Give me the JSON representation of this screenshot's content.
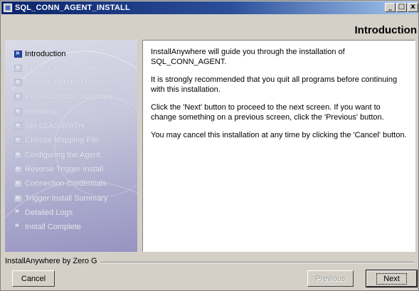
{
  "window": {
    "title": "SQL_CONN_AGENT_INSTALL",
    "controls": [
      "_",
      "□",
      "x"
    ]
  },
  "header": {
    "title": "Introduction"
  },
  "steps": [
    {
      "label": "Introduction",
      "state": "current"
    },
    {
      "label": "Choose Install Folder",
      "state": "pending"
    },
    {
      "label": "Choose Shortcut Folder",
      "state": "pending"
    },
    {
      "label": "Pre-Installation Summary",
      "state": "pending"
    },
    {
      "label": "Installing...",
      "state": "pending"
    },
    {
      "label": "Set CLASSPATH",
      "state": "pending"
    },
    {
      "label": "Choose Mapping File",
      "state": "pending"
    },
    {
      "label": "Configuring the Agent",
      "state": "pending"
    },
    {
      "label": "Reverse Trigger Install",
      "state": "pending"
    },
    {
      "label": "Connection Credentials",
      "state": "pending"
    },
    {
      "label": "Trigger Install Summary",
      "state": "pending"
    },
    {
      "label": "Detailed Logs",
      "state": "pending"
    },
    {
      "label": "Install Complete",
      "state": "pending"
    }
  ],
  "content": {
    "paragraphs": [
      "InstallAnywhere will guide you through the installation of SQL_CONN_AGENT.",
      "It is strongly recommended that you quit all programs before continuing with this installation.",
      "Click the 'Next' button to proceed to the next screen. If you want to change something on a previous screen, click the 'Previous' button.",
      "You may cancel this installation at any time by clicking the 'Cancel' button."
    ]
  },
  "footer": {
    "brand": "InstallAnywhere by Zero G",
    "cancel_label": "Cancel",
    "previous_label": "Previous",
    "next_label": "Next"
  }
}
